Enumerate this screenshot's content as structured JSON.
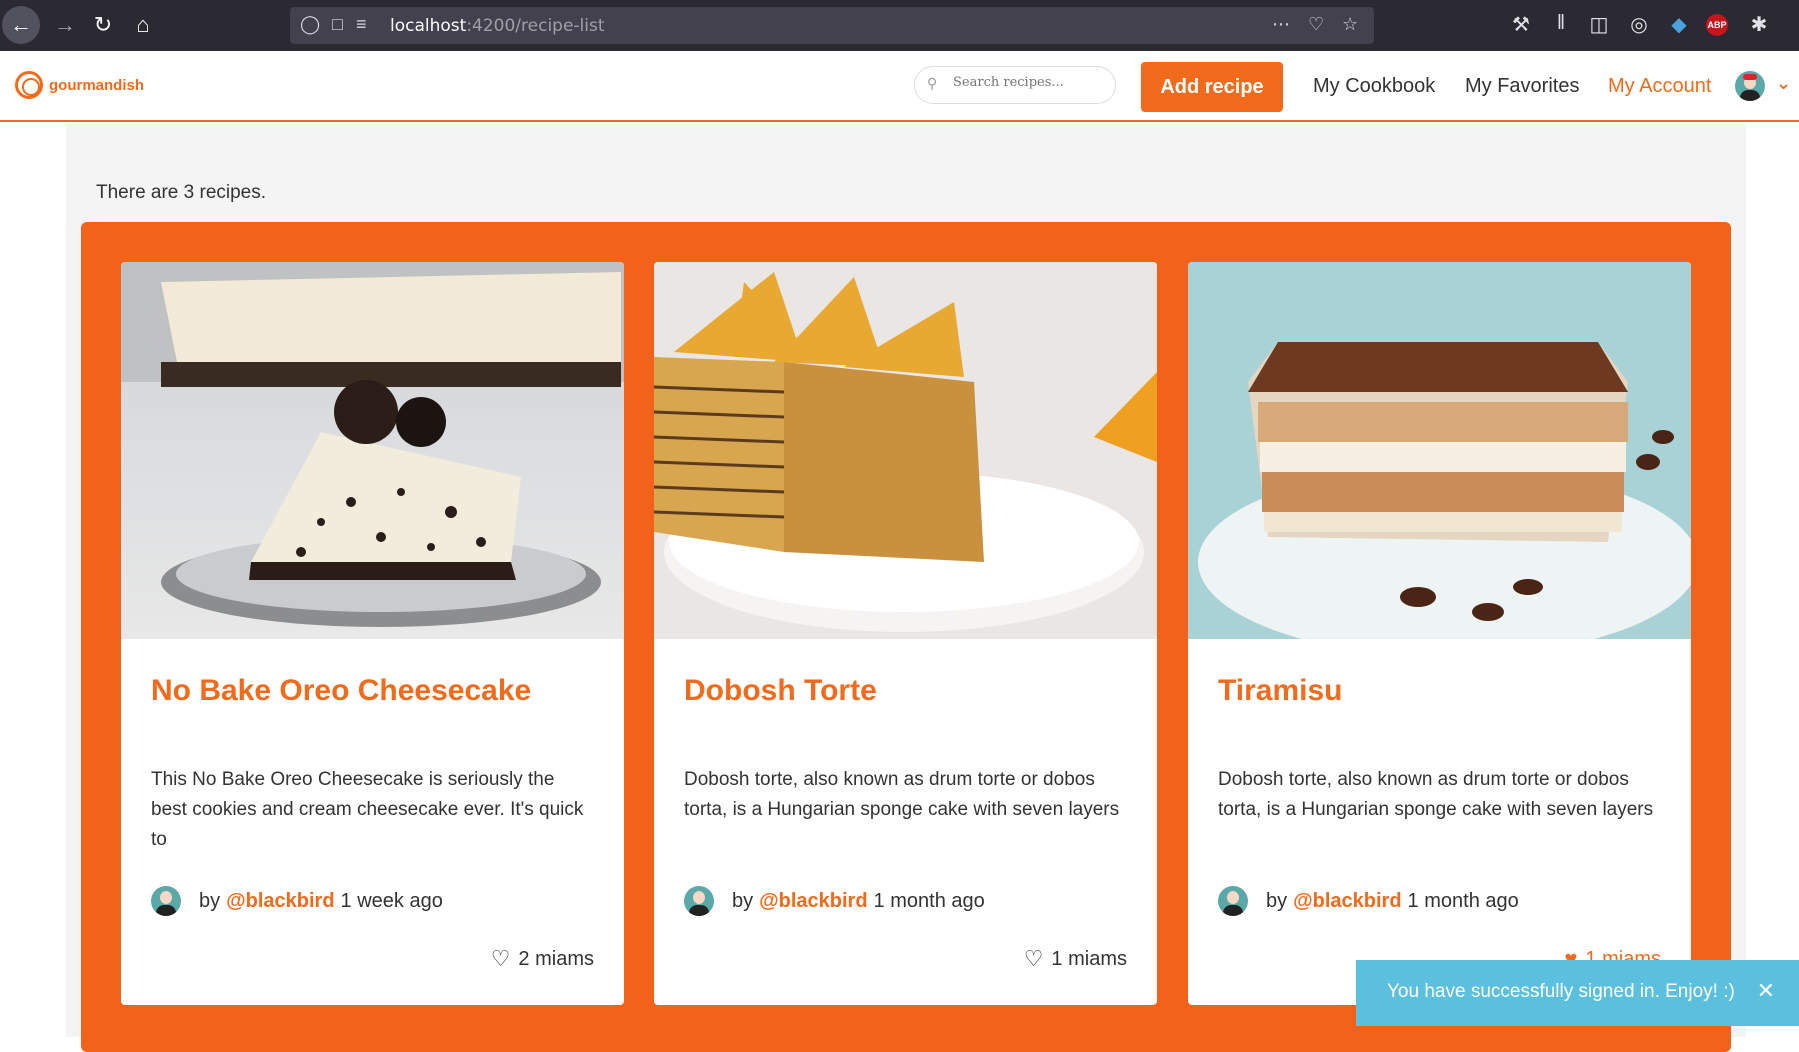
{
  "browser": {
    "url_host": "localhost",
    "url_path": ":4200/recipe-list",
    "abp_label": "ABP"
  },
  "header": {
    "logo_text": "gourmandish",
    "search_placeholder": "Search recipes...",
    "add_recipe_label": "Add recipe",
    "nav": [
      "My Cookbook",
      "My Favorites",
      "My Account"
    ]
  },
  "main": {
    "count_text": "There are 3 recipes."
  },
  "recipes": [
    {
      "title": "No Bake Oreo Cheesecake",
      "description": "This No Bake Oreo Cheesecake is seriously the best cookies and cream cheesecake ever. It's quick to",
      "by": "by",
      "author": "@blackbird",
      "time": "1 week ago",
      "miams": "2 miams"
    },
    {
      "title": "Dobosh Torte",
      "description": "Dobosh torte, also known as drum torte or dobos torta, is a Hungarian sponge cake with seven layers",
      "by": "by",
      "author": "@blackbird",
      "time": "1 month ago",
      "miams": "1 miams"
    },
    {
      "title": "Tiramisu",
      "description": "Dobosh torte, also known as drum torte or dobos torta, is a Hungarian sponge cake with seven layers",
      "by": "by",
      "author": "@blackbird",
      "time": "1 month ago",
      "miams": "1 miams"
    }
  ],
  "toast": {
    "message": "You have successfully signed in. Enjoy! :)"
  },
  "colors": {
    "accent": "#f26a1b",
    "toast": "#5bc0de"
  }
}
